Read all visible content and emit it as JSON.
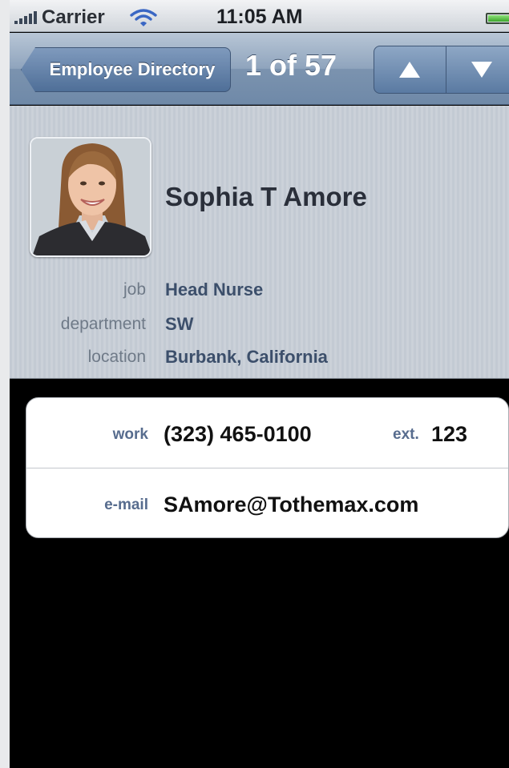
{
  "status_bar": {
    "carrier": "Carrier",
    "time": "11:05 AM",
    "icons": [
      "signal-icon",
      "wifi-icon",
      "battery-icon"
    ]
  },
  "nav": {
    "back_label": "Employee Directory",
    "counter": "1 of 57",
    "prev_icon": "triangle-up-icon",
    "next_icon": "triangle-down-icon"
  },
  "employee": {
    "name": "Sophia T Amore",
    "fields": [
      {
        "label": "job",
        "value": "Head Nurse"
      },
      {
        "label": "department",
        "value": "SW"
      },
      {
        "label": "location",
        "value": "Burbank, California"
      }
    ]
  },
  "contact": {
    "work_label": "work",
    "work_value": "(323) 465-0100",
    "ext_label": "ext.",
    "ext_value": "123",
    "email_label": "e-mail",
    "email_value": "SAmore@Tothemax.com"
  },
  "colors": {
    "nav_bar": "#7b93af",
    "header_bg": "#c7cdd5",
    "label_blue": "#576c8e",
    "value_navy": "#3c4f6b"
  }
}
